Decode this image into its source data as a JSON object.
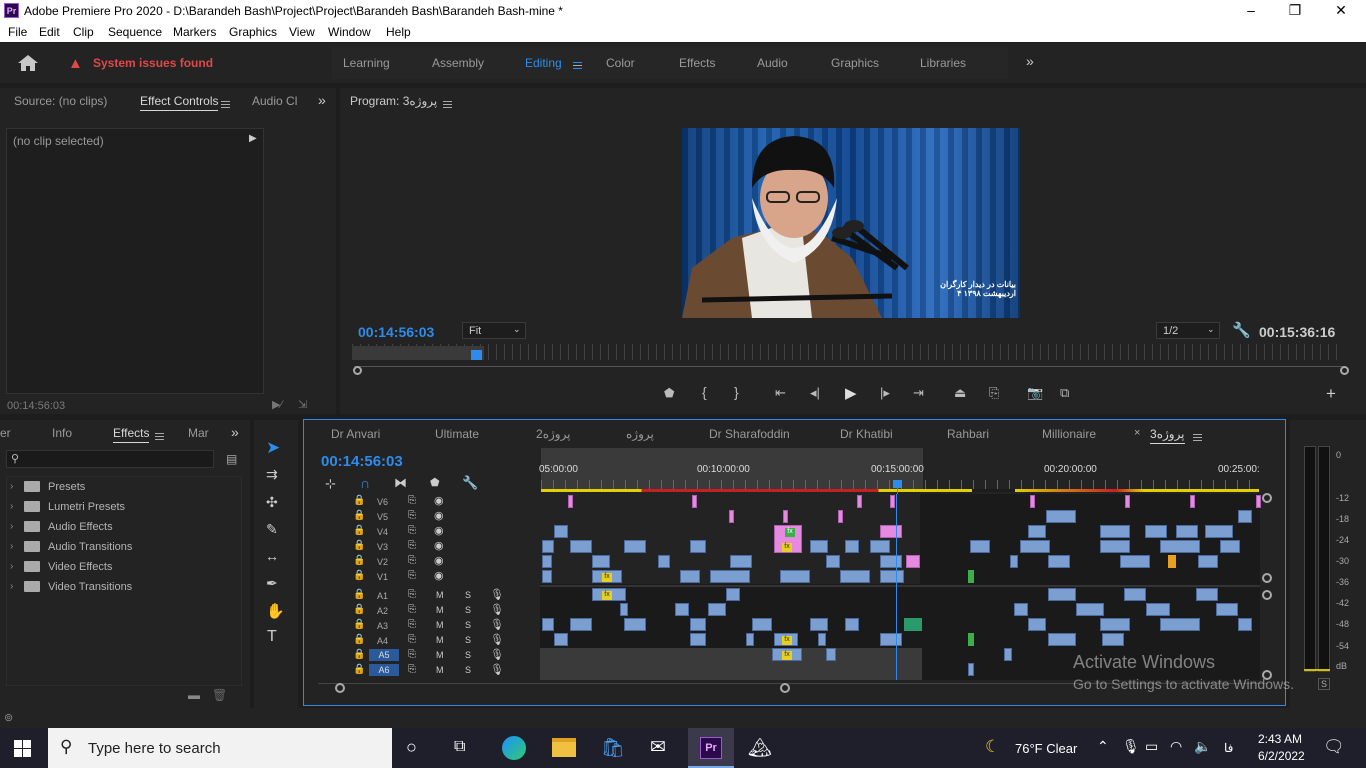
{
  "window": {
    "title": "Adobe Premiere Pro 2020 - D:\\Barandeh Bash\\Project\\Project\\Barandeh Bash\\Barandeh Bash-mine *",
    "logo": "Pr"
  },
  "menu": [
    "File",
    "Edit",
    "Clip",
    "Sequence",
    "Markers",
    "Graphics",
    "View",
    "Window",
    "Help"
  ],
  "workspace": {
    "issues": "System issues found",
    "tabs": [
      "Learning",
      "Assembly",
      "Editing",
      "Color",
      "Effects",
      "Audio",
      "Graphics",
      "Libraries"
    ],
    "active": "Editing"
  },
  "source_panel": {
    "tabs": [
      "Source: (no clips)",
      "Effect Controls",
      "Audio Cl"
    ],
    "no_clip": "(no clip selected)",
    "timecode": "00:14:56:03"
  },
  "program": {
    "title": "Program: پروژه3",
    "timecode": "00:14:56:03",
    "fit": "Fit",
    "resolution": "1/2",
    "duration": "00:15:36:16",
    "caption_line1": "بیانات در دیدار کارگران",
    "caption_line2": "۴ اردیبهشت ۱۳۹۸"
  },
  "effects_panel": {
    "tabs": [
      "er",
      "Info",
      "Effects",
      "Mar"
    ],
    "items": [
      "Presets",
      "Lumetri Presets",
      "Audio Effects",
      "Audio Transitions",
      "Video Effects",
      "Video Transitions"
    ]
  },
  "timeline": {
    "tabs": [
      "Dr Anvari",
      "Ultimate",
      "پروژه2",
      "پروژه",
      "Dr Sharafoddin",
      "Dr Khatibi",
      "Rahbari",
      "Millionaire",
      "پروژه3"
    ],
    "timecode": "00:14:56:03",
    "ruler": [
      "05:00:00",
      "00:10:00:00",
      "00:15:00:00",
      "00:20:00:00",
      "00:25:00:"
    ],
    "video_tracks": [
      "V6",
      "V5",
      "V4",
      "V3",
      "V2",
      "V1"
    ],
    "audio_tracks": [
      "A1",
      "A2",
      "A3",
      "A4",
      "A5",
      "A6"
    ],
    "m": "M",
    "s": "S"
  },
  "meter": {
    "labels": [
      "0",
      "-12",
      "-18",
      "-24",
      "-30",
      "-36",
      "-42",
      "-48",
      "-54",
      "dB"
    ],
    "s": "S"
  },
  "watermark": {
    "line1": "Activate Windows",
    "line2": "Go to Settings to activate Windows."
  },
  "taskbar": {
    "search": "Type here to search",
    "weather": "76°F  Clear",
    "lang": "فا",
    "time": "2:43 AM",
    "date": "6/2/2022"
  },
  "colors": {
    "accent": "#2d8ceb",
    "warning": "#e04848",
    "clip": "#7b9fd0",
    "pink": "#e58ae0"
  }
}
